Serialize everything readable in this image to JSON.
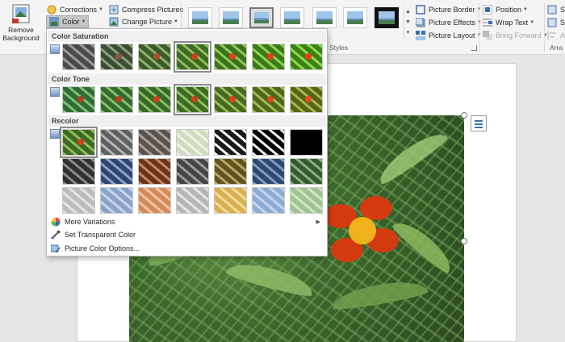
{
  "ribbon": {
    "adjust": {
      "remove_background_line1": "Remove",
      "remove_background_line2": "Background",
      "corrections": "Corrections",
      "color": "Color",
      "compress_pictures": "Compress Pictures",
      "change_picture": "Change Picture"
    },
    "picture_styles": {
      "group_label": "Styles",
      "picture_border": "Picture Border",
      "picture_effects": "Picture Effects",
      "picture_layout": "Picture Layout"
    },
    "arrange": {
      "position": "Position",
      "wrap_text": "Wrap Text",
      "bring_forward": "Bring Forward",
      "group_label": "Arra",
      "cut_items": [
        "Se",
        "Se",
        "Al"
      ]
    }
  },
  "color_menu": {
    "color_saturation": "Color Saturation",
    "color_tone": "Color Tone",
    "recolor": "Recolor",
    "more_variations": "More Variations",
    "set_transparent_color": "Set Transparent Color",
    "picture_color_options": "Picture Color Options...",
    "saturation_selected_index": 3,
    "tone_selected_index": 3,
    "recolor_selected_index": 0
  },
  "colors": {
    "accent_blue": "#3a6fb0",
    "selection_gray": "#8a8a8a",
    "leaf_green": "#4e7f35",
    "flower_red": "#d43a10"
  }
}
